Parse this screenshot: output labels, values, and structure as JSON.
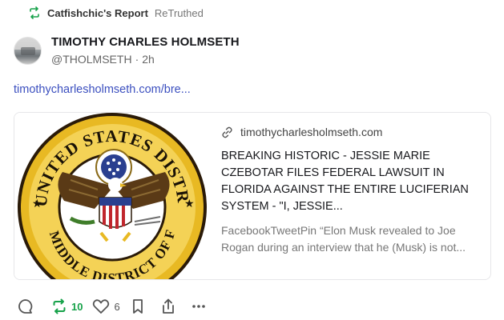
{
  "retruth": {
    "user": "Catfishchic's Report",
    "suffix": "ReTruthed"
  },
  "author": {
    "display_name": "TIMOTHY CHARLES HOLMSETH",
    "handle": "@THOLMSETH",
    "separator": "·",
    "time_ago": "2h"
  },
  "post": {
    "link_text": "timothycharlesholmseth.com/bre..."
  },
  "card": {
    "domain": "timothycharlesholmseth.com",
    "title": "BREAKING HISTORIC - JESSIE MARIE CZEBOTAR FILES FEDERAL LAWSUIT in FLORIDA AGAINST the ENTIRE LUCIFERIAN SYSTEM - \"I, Jessie...",
    "description": "FacebookTweetPin “Elon Musk revealed to Joe Rogan during an interview that he (Musk) is not...",
    "image_seal": {
      "top_text": "UNITED STATES DISTRICT COURT",
      "bottom_text": "MIDDLE DISTRICT OF FLORIDA"
    }
  },
  "actions": {
    "reply_icon": "reply-icon",
    "retruth_count": "10",
    "like_count": "6",
    "save_icon": "bookmark-icon",
    "share_icon": "share-icon",
    "more_icon": "more-icon"
  },
  "colors": {
    "accent_green": "#17a24a",
    "link_blue": "#3b4fbf",
    "seal_gold": "#e8b923"
  }
}
